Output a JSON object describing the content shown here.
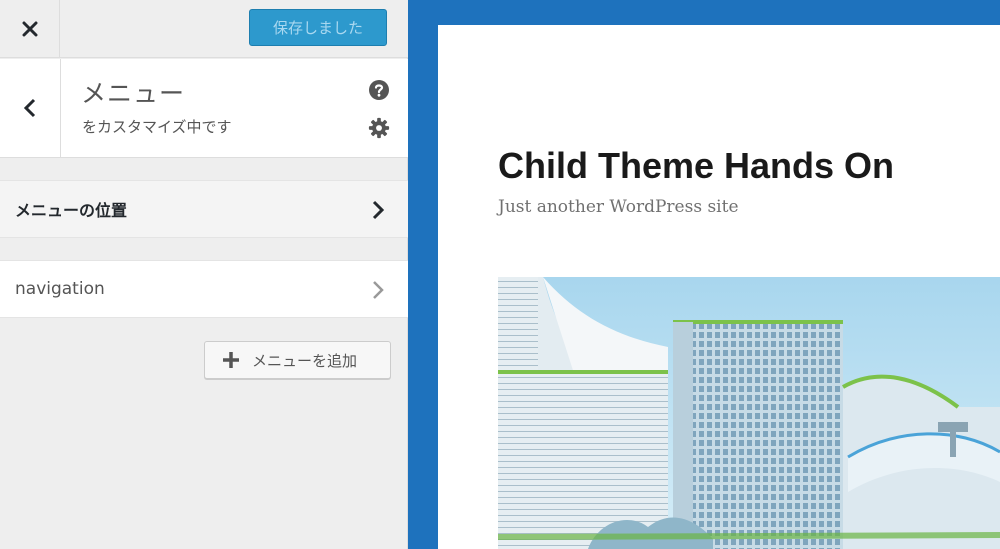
{
  "topbar": {
    "close_icon": "close-icon",
    "save_label": "保存しました"
  },
  "section": {
    "back_icon": "chevron-left-icon",
    "title": "メニュー",
    "subtitle": "をカスタマイズ中です",
    "help_icon": "help-icon",
    "gear_icon": "gear-icon"
  },
  "menu_locations": {
    "label": "メニューの位置",
    "icon": "chevron-right-icon"
  },
  "menus": [
    {
      "label": "navigation",
      "icon": "chevron-right-icon"
    }
  ],
  "add_menu": {
    "label": "メニューを追加",
    "icon": "plus-icon"
  },
  "preview": {
    "site_title": "Child Theme Hands On",
    "site_description": "Just another WordPress site",
    "header_image": "city-buildings-illustration"
  },
  "colors": {
    "accent_blue": "#1e72bd",
    "save_button": "#2d99cd",
    "sidebar_bg": "#eeeeee"
  }
}
